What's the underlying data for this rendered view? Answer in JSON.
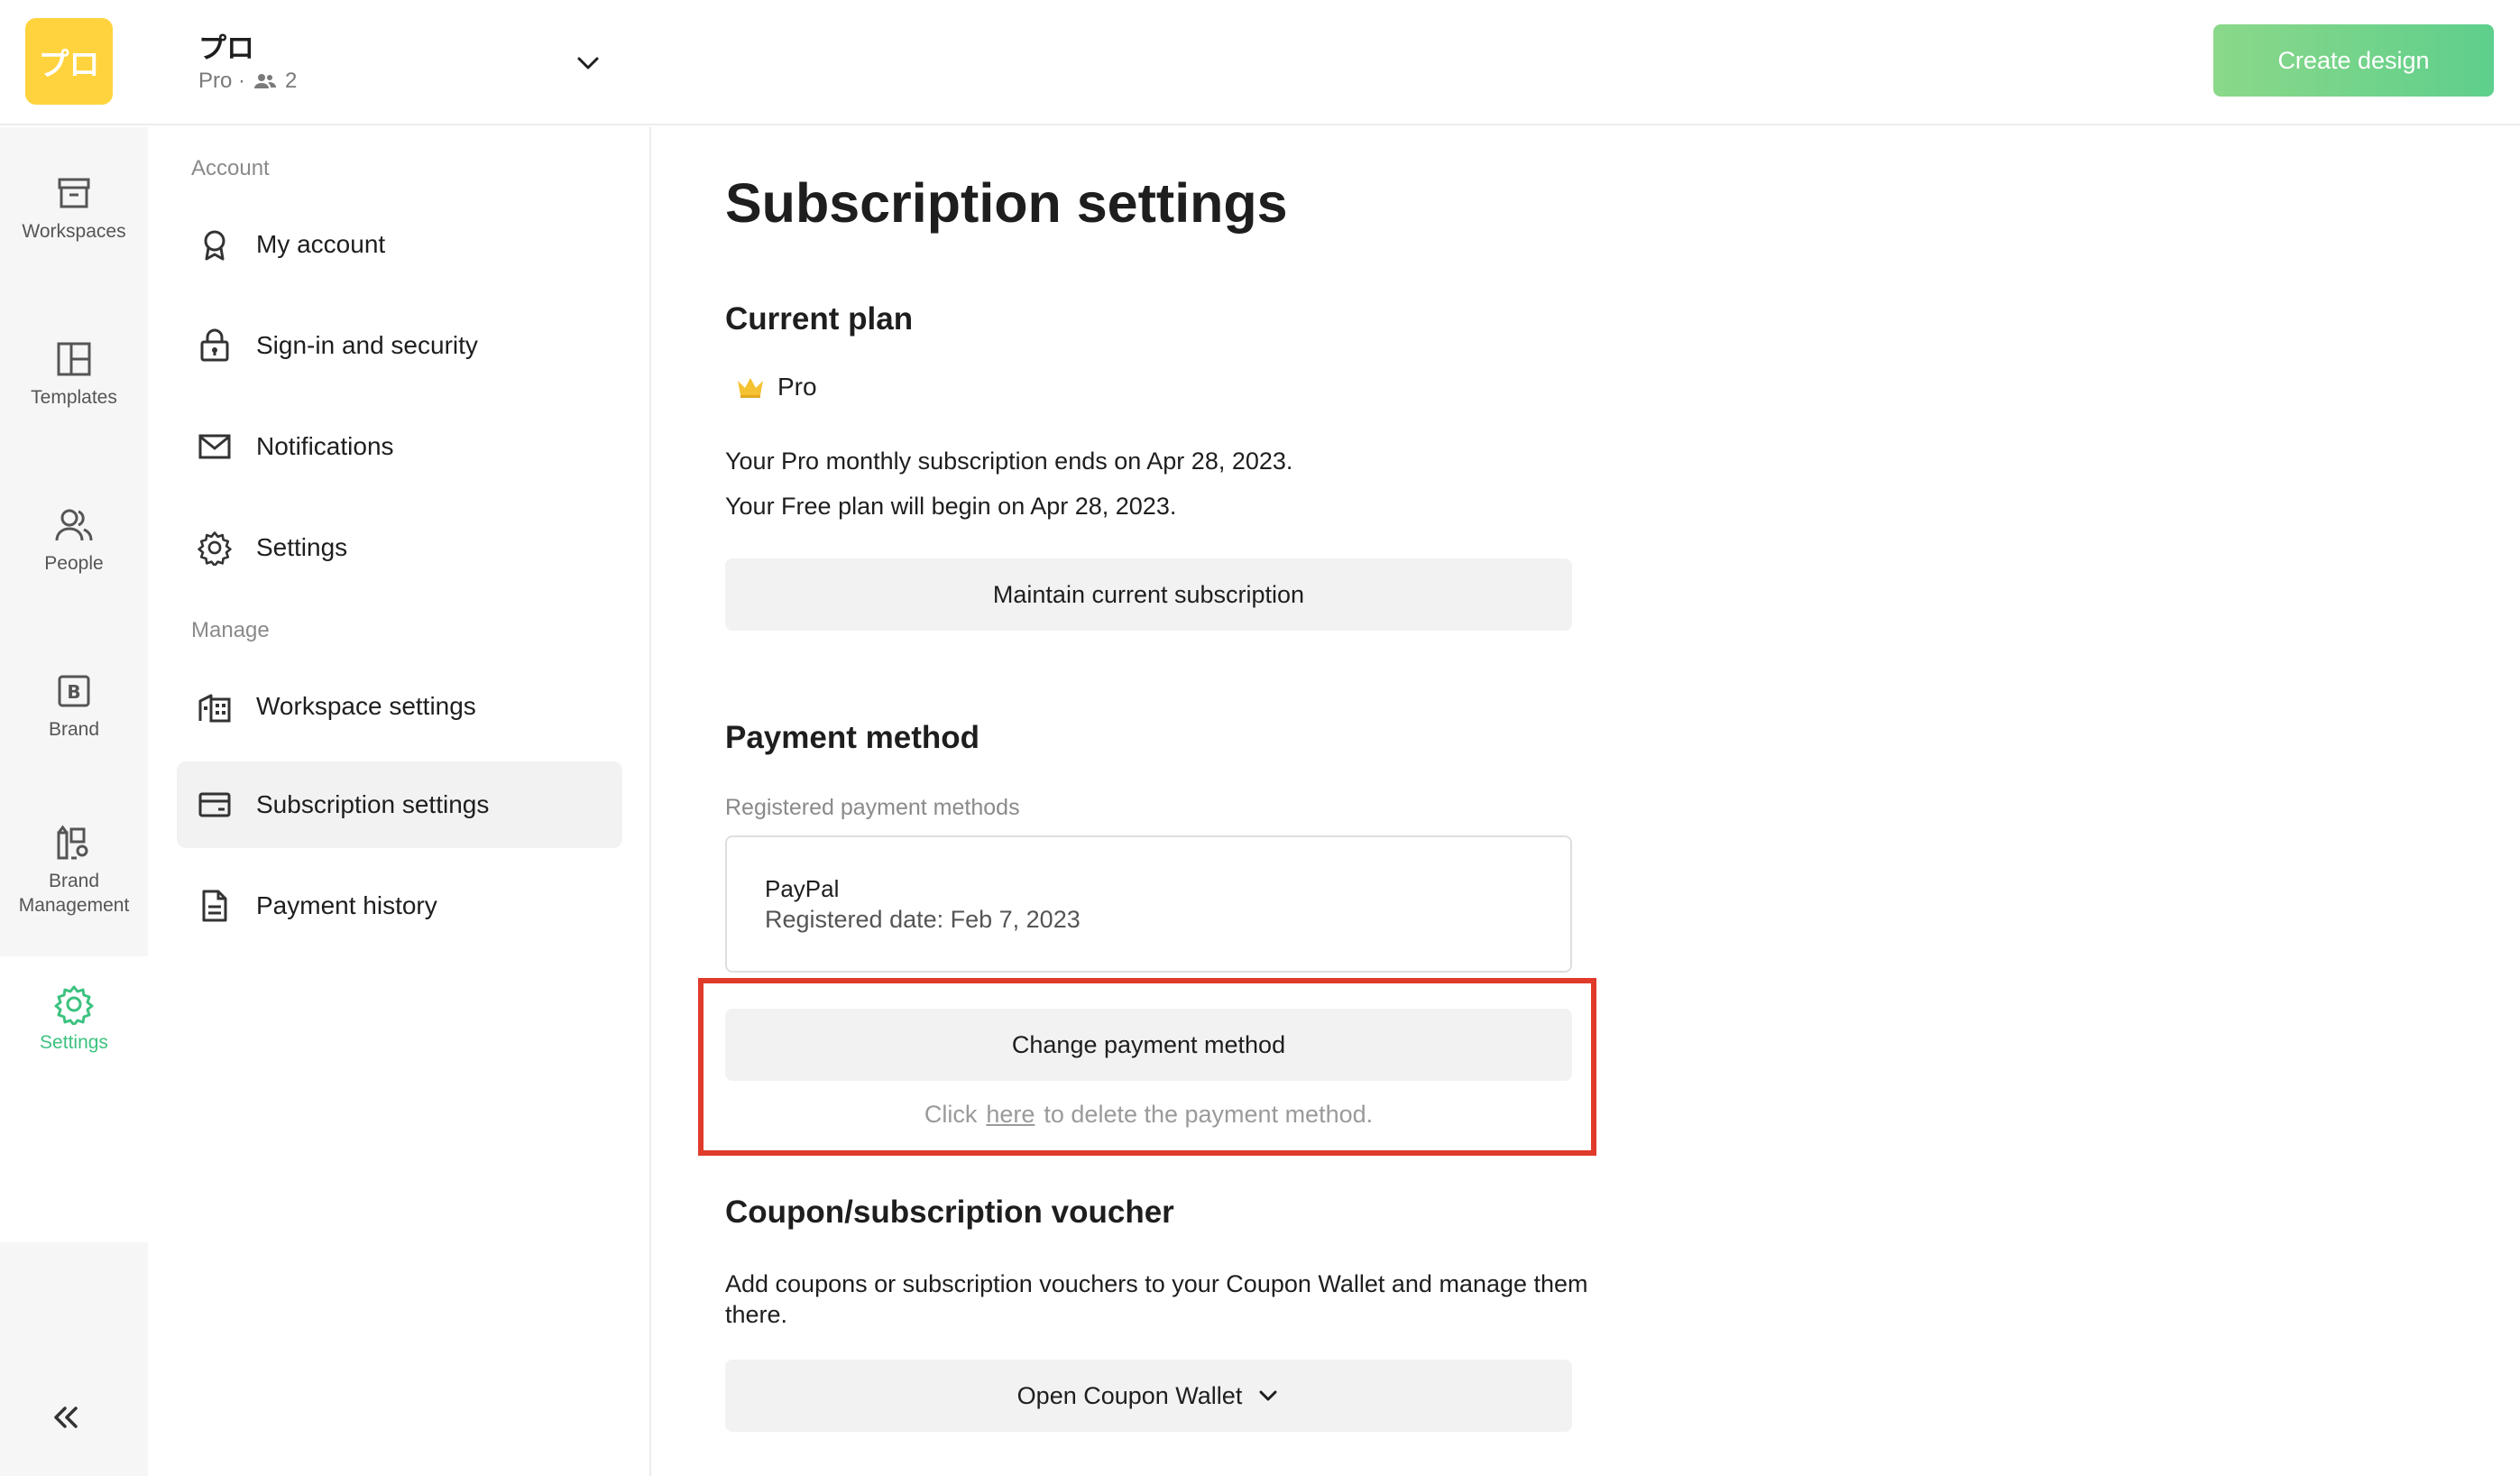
{
  "header": {
    "workspace_logo_text": "プロ",
    "workspace_name": "プロ",
    "workspace_plan": "Pro ·",
    "member_count": "2",
    "create_button": "Create design",
    "brand_color": "#5ecf8c",
    "logo_color": "#ffd33d"
  },
  "rail": {
    "items": [
      {
        "label": "Workspaces",
        "icon": "archive-icon"
      },
      {
        "label": "Templates",
        "icon": "layout-icon"
      },
      {
        "label": "People",
        "icon": "people-icon"
      },
      {
        "label": "Brand",
        "icon": "brand-icon"
      },
      {
        "label_line1": "Brand",
        "label_line2": "Management",
        "icon": "brand-management-icon"
      },
      {
        "label": "Settings",
        "icon": "gear-icon",
        "active": true
      }
    ],
    "collapse_icon": "double-chevron-left-icon"
  },
  "sidebar": {
    "account_label": "Account",
    "manage_label": "Manage",
    "account_items": [
      {
        "label": "My account",
        "icon": "badge-icon"
      },
      {
        "label": "Sign-in and security",
        "icon": "lock-icon"
      },
      {
        "label": "Notifications",
        "icon": "mail-icon"
      },
      {
        "label": "Settings",
        "icon": "gear-icon"
      }
    ],
    "manage_items": [
      {
        "label": "Workspace settings",
        "icon": "building-icon"
      },
      {
        "label": "Subscription settings",
        "icon": "card-icon",
        "selected": true
      },
      {
        "label": "Payment history",
        "icon": "document-icon"
      }
    ]
  },
  "main": {
    "title": "Subscription settings",
    "current_plan": {
      "heading": "Current plan",
      "plan_icon": "crown-icon",
      "plan_name": "Pro",
      "line1": "Your Pro monthly subscription ends on Apr 28, 2023.",
      "line2": "Your Free plan will begin on Apr 28, 2023.",
      "button": "Maintain current subscription"
    },
    "payment_method": {
      "heading": "Payment method",
      "registered_label": "Registered payment methods",
      "method_name": "PayPal",
      "registered_date": "Registered date: Feb 7, 2023",
      "change_button": "Change payment method",
      "hint_before": "Click",
      "hint_link": "here",
      "hint_after": "to delete the payment method.",
      "highlight_color": "#e03a2a"
    },
    "coupon": {
      "heading": "Coupon/subscription voucher",
      "description": "Add coupons or subscription vouchers to your Coupon Wallet and manage them there.",
      "button": "Open Coupon Wallet"
    }
  }
}
